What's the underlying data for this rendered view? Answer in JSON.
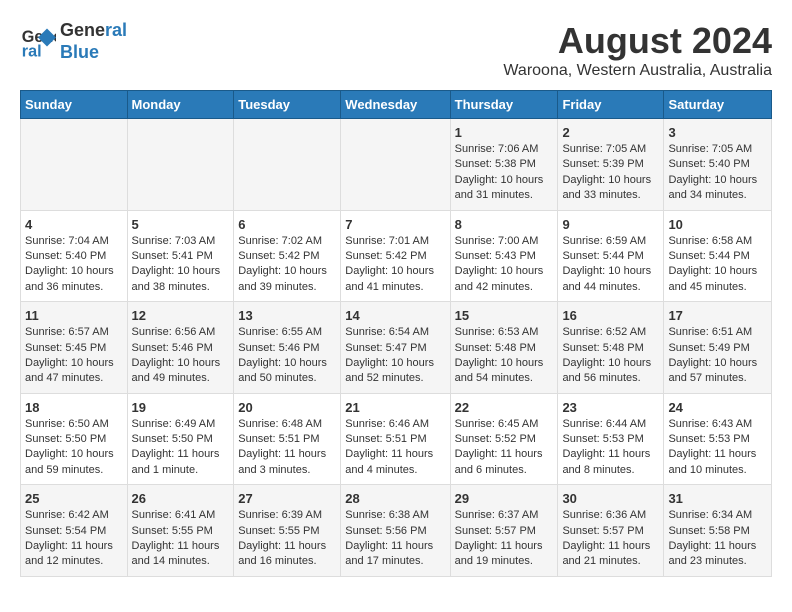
{
  "header": {
    "logo_line1": "General",
    "logo_line2": "Blue",
    "month_title": "August 2024",
    "location": "Waroona, Western Australia, Australia"
  },
  "days_of_week": [
    "Sunday",
    "Monday",
    "Tuesday",
    "Wednesday",
    "Thursday",
    "Friday",
    "Saturday"
  ],
  "weeks": [
    [
      {
        "day": "",
        "text": ""
      },
      {
        "day": "",
        "text": ""
      },
      {
        "day": "",
        "text": ""
      },
      {
        "day": "",
        "text": ""
      },
      {
        "day": "1",
        "text": "Sunrise: 7:06 AM\nSunset: 5:38 PM\nDaylight: 10 hours\nand 31 minutes."
      },
      {
        "day": "2",
        "text": "Sunrise: 7:05 AM\nSunset: 5:39 PM\nDaylight: 10 hours\nand 33 minutes."
      },
      {
        "day": "3",
        "text": "Sunrise: 7:05 AM\nSunset: 5:40 PM\nDaylight: 10 hours\nand 34 minutes."
      }
    ],
    [
      {
        "day": "4",
        "text": "Sunrise: 7:04 AM\nSunset: 5:40 PM\nDaylight: 10 hours\nand 36 minutes."
      },
      {
        "day": "5",
        "text": "Sunrise: 7:03 AM\nSunset: 5:41 PM\nDaylight: 10 hours\nand 38 minutes."
      },
      {
        "day": "6",
        "text": "Sunrise: 7:02 AM\nSunset: 5:42 PM\nDaylight: 10 hours\nand 39 minutes."
      },
      {
        "day": "7",
        "text": "Sunrise: 7:01 AM\nSunset: 5:42 PM\nDaylight: 10 hours\nand 41 minutes."
      },
      {
        "day": "8",
        "text": "Sunrise: 7:00 AM\nSunset: 5:43 PM\nDaylight: 10 hours\nand 42 minutes."
      },
      {
        "day": "9",
        "text": "Sunrise: 6:59 AM\nSunset: 5:44 PM\nDaylight: 10 hours\nand 44 minutes."
      },
      {
        "day": "10",
        "text": "Sunrise: 6:58 AM\nSunset: 5:44 PM\nDaylight: 10 hours\nand 45 minutes."
      }
    ],
    [
      {
        "day": "11",
        "text": "Sunrise: 6:57 AM\nSunset: 5:45 PM\nDaylight: 10 hours\nand 47 minutes."
      },
      {
        "day": "12",
        "text": "Sunrise: 6:56 AM\nSunset: 5:46 PM\nDaylight: 10 hours\nand 49 minutes."
      },
      {
        "day": "13",
        "text": "Sunrise: 6:55 AM\nSunset: 5:46 PM\nDaylight: 10 hours\nand 50 minutes."
      },
      {
        "day": "14",
        "text": "Sunrise: 6:54 AM\nSunset: 5:47 PM\nDaylight: 10 hours\nand 52 minutes."
      },
      {
        "day": "15",
        "text": "Sunrise: 6:53 AM\nSunset: 5:48 PM\nDaylight: 10 hours\nand 54 minutes."
      },
      {
        "day": "16",
        "text": "Sunrise: 6:52 AM\nSunset: 5:48 PM\nDaylight: 10 hours\nand 56 minutes."
      },
      {
        "day": "17",
        "text": "Sunrise: 6:51 AM\nSunset: 5:49 PM\nDaylight: 10 hours\nand 57 minutes."
      }
    ],
    [
      {
        "day": "18",
        "text": "Sunrise: 6:50 AM\nSunset: 5:50 PM\nDaylight: 10 hours\nand 59 minutes."
      },
      {
        "day": "19",
        "text": "Sunrise: 6:49 AM\nSunset: 5:50 PM\nDaylight: 11 hours\nand 1 minute."
      },
      {
        "day": "20",
        "text": "Sunrise: 6:48 AM\nSunset: 5:51 PM\nDaylight: 11 hours\nand 3 minutes."
      },
      {
        "day": "21",
        "text": "Sunrise: 6:46 AM\nSunset: 5:51 PM\nDaylight: 11 hours\nand 4 minutes."
      },
      {
        "day": "22",
        "text": "Sunrise: 6:45 AM\nSunset: 5:52 PM\nDaylight: 11 hours\nand 6 minutes."
      },
      {
        "day": "23",
        "text": "Sunrise: 6:44 AM\nSunset: 5:53 PM\nDaylight: 11 hours\nand 8 minutes."
      },
      {
        "day": "24",
        "text": "Sunrise: 6:43 AM\nSunset: 5:53 PM\nDaylight: 11 hours\nand 10 minutes."
      }
    ],
    [
      {
        "day": "25",
        "text": "Sunrise: 6:42 AM\nSunset: 5:54 PM\nDaylight: 11 hours\nand 12 minutes."
      },
      {
        "day": "26",
        "text": "Sunrise: 6:41 AM\nSunset: 5:55 PM\nDaylight: 11 hours\nand 14 minutes."
      },
      {
        "day": "27",
        "text": "Sunrise: 6:39 AM\nSunset: 5:55 PM\nDaylight: 11 hours\nand 16 minutes."
      },
      {
        "day": "28",
        "text": "Sunrise: 6:38 AM\nSunset: 5:56 PM\nDaylight: 11 hours\nand 17 minutes."
      },
      {
        "day": "29",
        "text": "Sunrise: 6:37 AM\nSunset: 5:57 PM\nDaylight: 11 hours\nand 19 minutes."
      },
      {
        "day": "30",
        "text": "Sunrise: 6:36 AM\nSunset: 5:57 PM\nDaylight: 11 hours\nand 21 minutes."
      },
      {
        "day": "31",
        "text": "Sunrise: 6:34 AM\nSunset: 5:58 PM\nDaylight: 11 hours\nand 23 minutes."
      }
    ]
  ]
}
